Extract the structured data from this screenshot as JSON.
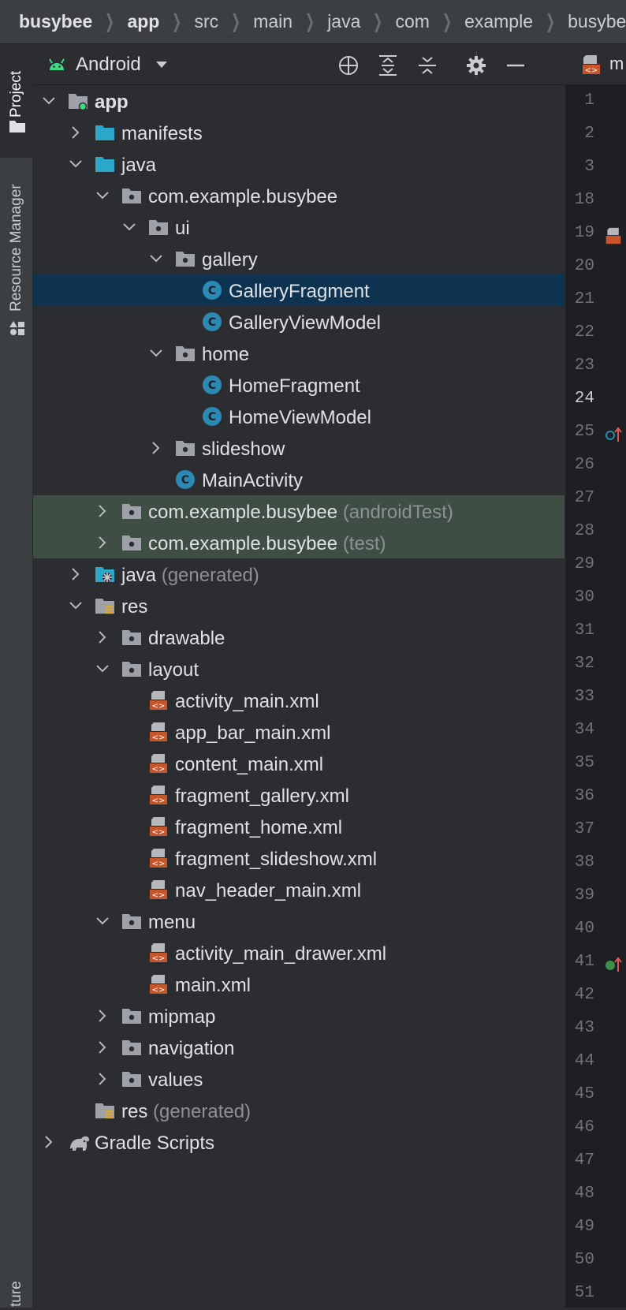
{
  "breadcrumb": {
    "items": [
      "busybee",
      "app",
      "src",
      "main",
      "java",
      "com",
      "example",
      "busybee"
    ],
    "bold": [
      true,
      true,
      false,
      false,
      false,
      false,
      false,
      false
    ]
  },
  "tool_stripe": {
    "project_label": "Project",
    "resource_manager_label": "Resource Manager",
    "structure_label_partial": "ture"
  },
  "panel": {
    "view_label": "Android",
    "icons": {
      "view": "android-icon",
      "select_opened": "crosshair-icon",
      "expand_all": "expand-all-icon",
      "collapse_all": "collapse-all-icon",
      "settings": "gear-icon",
      "hide": "minimize-icon"
    }
  },
  "tree": [
    {
      "label": "app",
      "suffix": "",
      "depth": 0,
      "expanded": true,
      "icon": "module-folder",
      "bold": true
    },
    {
      "label": "manifests",
      "suffix": "",
      "depth": 1,
      "expanded": false,
      "icon": "source-folder"
    },
    {
      "label": "java",
      "suffix": "",
      "depth": 1,
      "expanded": true,
      "icon": "source-folder"
    },
    {
      "label": "com.example.busybee",
      "suffix": "",
      "depth": 2,
      "expanded": true,
      "icon": "package"
    },
    {
      "label": "ui",
      "suffix": "",
      "depth": 3,
      "expanded": true,
      "icon": "package"
    },
    {
      "label": "gallery",
      "suffix": "",
      "depth": 4,
      "expanded": true,
      "icon": "package"
    },
    {
      "label": "GalleryFragment",
      "suffix": "",
      "depth": 5,
      "expanded": null,
      "icon": "class",
      "selected": true
    },
    {
      "label": "GalleryViewModel",
      "suffix": "",
      "depth": 5,
      "expanded": null,
      "icon": "class"
    },
    {
      "label": "home",
      "suffix": "",
      "depth": 4,
      "expanded": true,
      "icon": "package"
    },
    {
      "label": "HomeFragment",
      "suffix": "",
      "depth": 5,
      "expanded": null,
      "icon": "class"
    },
    {
      "label": "HomeViewModel",
      "suffix": "",
      "depth": 5,
      "expanded": null,
      "icon": "class"
    },
    {
      "label": "slideshow",
      "suffix": "",
      "depth": 4,
      "expanded": false,
      "icon": "package"
    },
    {
      "label": "MainActivity",
      "suffix": "",
      "depth": 4,
      "expanded": null,
      "icon": "class"
    },
    {
      "label": "com.example.busybee",
      "suffix": "(androidTest)",
      "depth": 2,
      "expanded": false,
      "icon": "package",
      "test": true
    },
    {
      "label": "com.example.busybee",
      "suffix": "(test)",
      "depth": 2,
      "expanded": false,
      "icon": "package",
      "test": true
    },
    {
      "label": "java",
      "suffix": "(generated)",
      "depth": 1,
      "expanded": false,
      "icon": "generated-folder"
    },
    {
      "label": "res",
      "suffix": "",
      "depth": 1,
      "expanded": true,
      "icon": "res-folder"
    },
    {
      "label": "drawable",
      "suffix": "",
      "depth": 2,
      "expanded": false,
      "icon": "package"
    },
    {
      "label": "layout",
      "suffix": "",
      "depth": 2,
      "expanded": true,
      "icon": "package"
    },
    {
      "label": "activity_main.xml",
      "suffix": "",
      "depth": 3,
      "expanded": null,
      "icon": "xml"
    },
    {
      "label": "app_bar_main.xml",
      "suffix": "",
      "depth": 3,
      "expanded": null,
      "icon": "xml"
    },
    {
      "label": "content_main.xml",
      "suffix": "",
      "depth": 3,
      "expanded": null,
      "icon": "xml"
    },
    {
      "label": "fragment_gallery.xml",
      "suffix": "",
      "depth": 3,
      "expanded": null,
      "icon": "xml"
    },
    {
      "label": "fragment_home.xml",
      "suffix": "",
      "depth": 3,
      "expanded": null,
      "icon": "xml"
    },
    {
      "label": "fragment_slideshow.xml",
      "suffix": "",
      "depth": 3,
      "expanded": null,
      "icon": "xml"
    },
    {
      "label": "nav_header_main.xml",
      "suffix": "",
      "depth": 3,
      "expanded": null,
      "icon": "xml"
    },
    {
      "label": "menu",
      "suffix": "",
      "depth": 2,
      "expanded": true,
      "icon": "package"
    },
    {
      "label": "activity_main_drawer.xml",
      "suffix": "",
      "depth": 3,
      "expanded": null,
      "icon": "xml"
    },
    {
      "label": "main.xml",
      "suffix": "",
      "depth": 3,
      "expanded": null,
      "icon": "xml"
    },
    {
      "label": "mipmap",
      "suffix": "",
      "depth": 2,
      "expanded": false,
      "icon": "package"
    },
    {
      "label": "navigation",
      "suffix": "",
      "depth": 2,
      "expanded": false,
      "icon": "package"
    },
    {
      "label": "values",
      "suffix": "",
      "depth": 2,
      "expanded": false,
      "icon": "package"
    },
    {
      "label": "res",
      "suffix": "(generated)",
      "depth": 1,
      "expanded": null,
      "icon": "res-folder"
    },
    {
      "label": "Gradle Scripts",
      "suffix": "",
      "depth": 0,
      "expanded": false,
      "icon": "gradle"
    }
  ],
  "editor": {
    "tab_label": "m",
    "line_numbers": [
      "1",
      "2",
      "3",
      "18",
      "19",
      "20",
      "21",
      "22",
      "23",
      "24",
      "25",
      "26",
      "27",
      "28",
      "29",
      "30",
      "31",
      "32",
      "33",
      "34",
      "35",
      "36",
      "37",
      "38",
      "39",
      "40",
      "41",
      "42",
      "43",
      "44",
      "45",
      "46",
      "47",
      "48",
      "49",
      "50",
      "51"
    ],
    "current_line": "24",
    "markers": [
      {
        "line": "19",
        "icon": "xml-file-icon"
      },
      {
        "line": "25",
        "icon": "override-up-icon"
      },
      {
        "line": "41",
        "icon": "implements-up-icon"
      }
    ]
  },
  "colors": {
    "selected_row": "#0d3350",
    "test_row": "#3f4e44",
    "class_icon": "#2b89b3",
    "xml_icon": "#c8552a",
    "android_green": "#3ddc84",
    "source_folder": "#2aa7c9"
  }
}
